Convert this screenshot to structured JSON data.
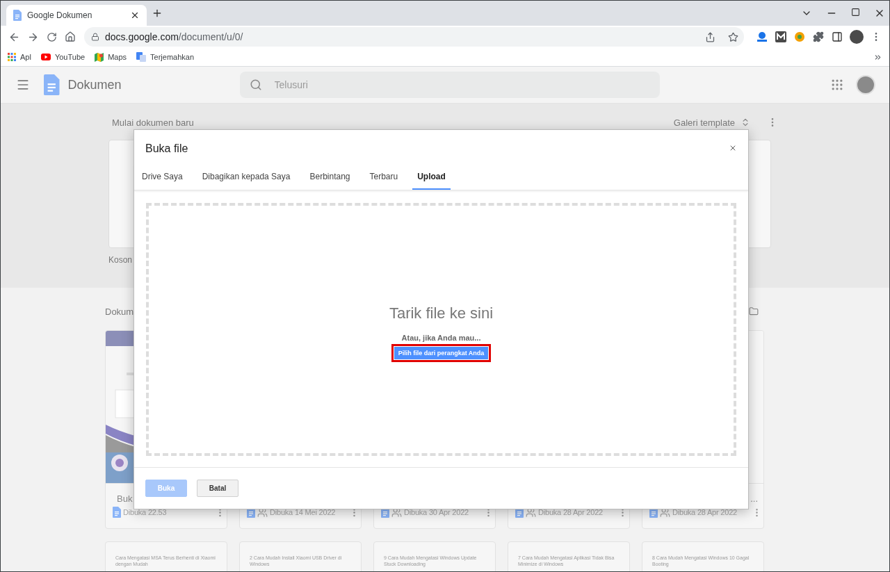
{
  "browser": {
    "tab": {
      "title": "Google Dokumen"
    },
    "address": {
      "host": "docs.google.com",
      "path": "/document/u/0/"
    },
    "bookmarks": [
      {
        "label": "Apl",
        "kind": "apps"
      },
      {
        "label": "YouTube",
        "kind": "youtube"
      },
      {
        "label": "Maps",
        "kind": "maps"
      },
      {
        "label": "Terjemahkan",
        "kind": "translate"
      }
    ]
  },
  "app_header": {
    "title": "Dokumen",
    "search": {
      "placeholder": "Telusuri"
    }
  },
  "templates": {
    "heading": "Mulai dokumen baru",
    "gallery": "Galeri template",
    "cards": [
      {
        "label": "Koson"
      }
    ]
  },
  "documents": {
    "heading": "Dokum",
    "cards": [
      {
        "title": "Buk",
        "shared": false,
        "date": "Dibuka 22.53",
        "kind": "picture"
      },
      {
        "shared": true,
        "date": "Dibuka 14 Mei 2022"
      },
      {
        "shared": true,
        "date": "Dibuka 30 Apr 2022"
      },
      {
        "shared": true,
        "date": "Dibuka 28 Apr 2022"
      },
      {
        "title": "...",
        "kind": "truncated",
        "shared": true,
        "date": "Dibuka 28 Apr 2022"
      }
    ],
    "second_row": [
      {
        "snippet": "Cara Mengatasi MSA Terus Berhenti di Xiaomi dengan Mudah"
      },
      {
        "snippet": "2 Cara Mudah Install Xiaomi USB Driver di Windows"
      },
      {
        "snippet": "9 Cara Mudah Mengatasi Windows Update Stuck Downloading"
      },
      {
        "snippet": "7 Cara Mudah Mengatasi Aplikasi Tidak Bisa Minimize di Windows"
      },
      {
        "snippet": "8 Cara Mudah Mengatasi Windows 10 Gagal Booting"
      }
    ]
  },
  "dialog": {
    "title": "Buka file",
    "tabs": [
      {
        "label": "Drive Saya",
        "selected": false
      },
      {
        "label": "Dibagikan kepada Saya",
        "selected": false
      },
      {
        "label": "Berbintang",
        "selected": false
      },
      {
        "label": "Terbaru",
        "selected": false
      },
      {
        "label": "Upload",
        "selected": true
      }
    ],
    "drop_title": "Tarik file ke sini",
    "alternative": "Atau, jika Anda mau...",
    "pick_button": {
      "label": "Pilih file dari perangkat Anda",
      "highlighted": true
    },
    "buttons": [
      {
        "label": "Buka",
        "disabled": true
      },
      {
        "label": "Batal",
        "disabled": false
      }
    ]
  }
}
